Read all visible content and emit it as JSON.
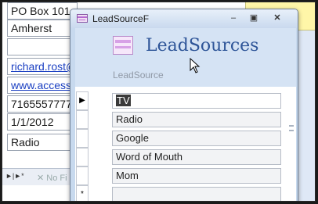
{
  "background_form": {
    "address": "PO Box 101",
    "city": "Amherst",
    "blank": "",
    "email": "richard.rost@",
    "website": "www.accessl",
    "phone": "7165557777",
    "date": "1/1/2012",
    "lead_source": "Radio",
    "nav_no_filter": "No Fi"
  },
  "popup": {
    "window_title": "LeadSourceF",
    "form_title": "LeadSources",
    "field_label": "LeadSource",
    "records": [
      "TV",
      "Radio",
      "Google",
      "Word of Mouth",
      "Mom",
      ""
    ],
    "current_record_index": 0,
    "new_record_marker": "*",
    "current_record_marker": "▶"
  },
  "colors": {
    "title_blue": "#2e5598",
    "header_band": "#d5e3f4",
    "link_blue": "#1a3fc2"
  }
}
